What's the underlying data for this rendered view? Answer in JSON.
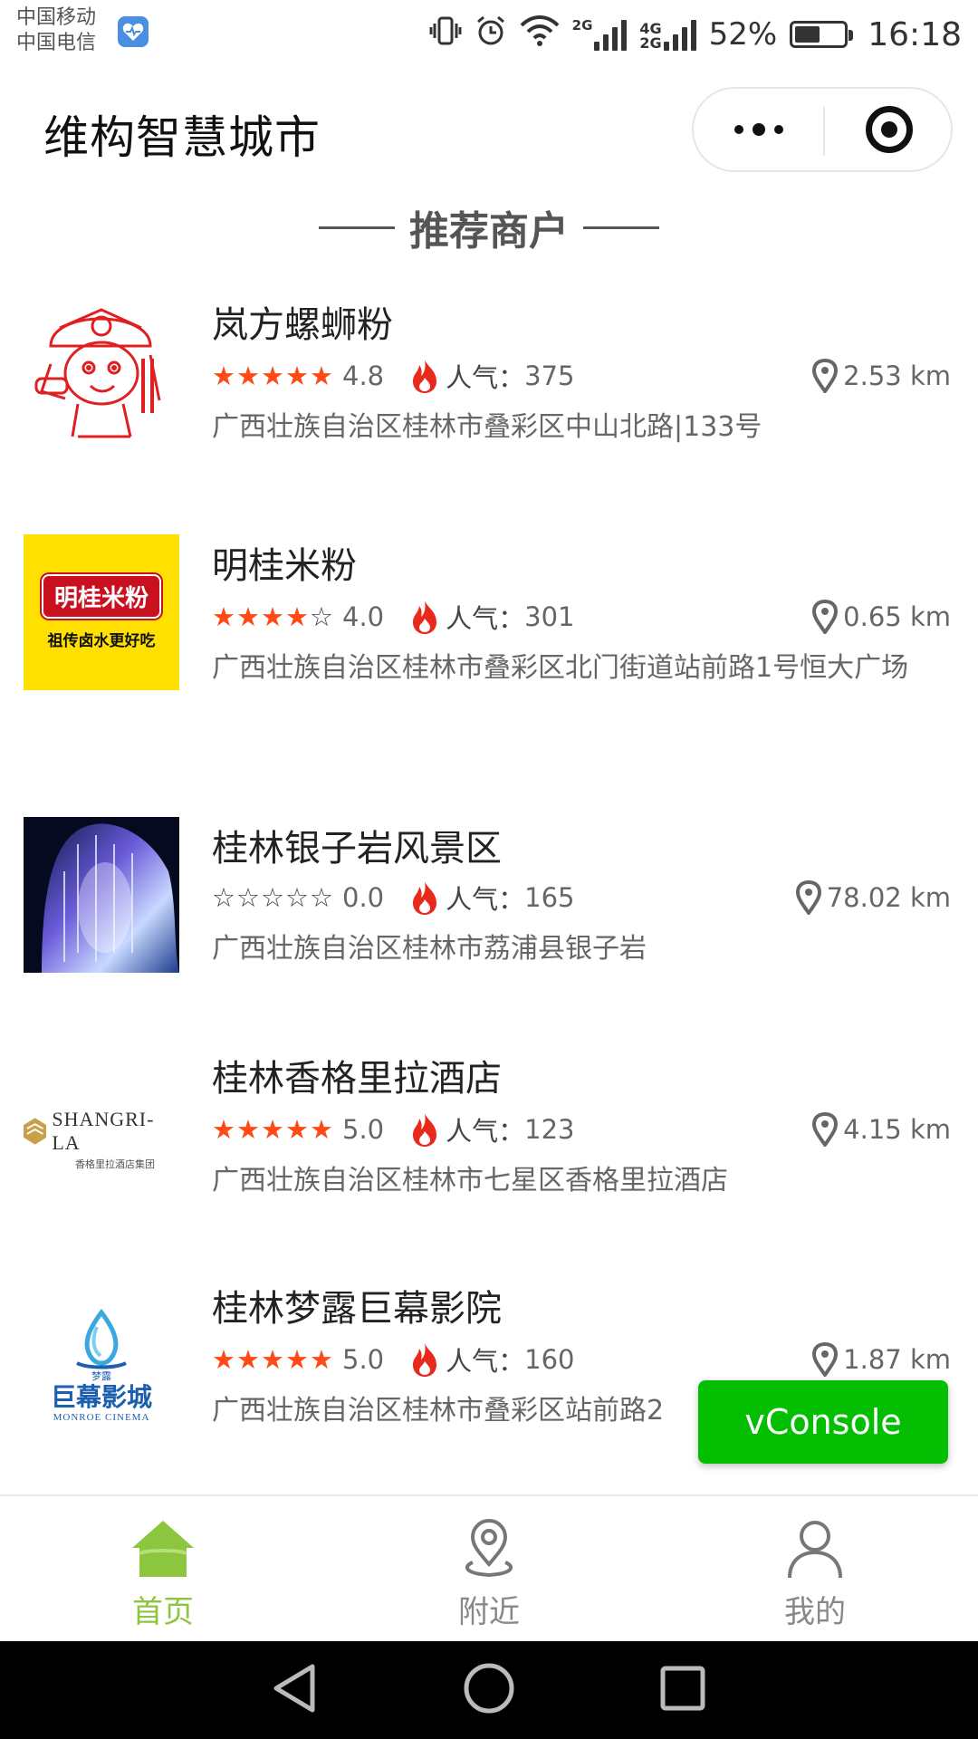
{
  "status_bar": {
    "carrier_1": "中国移动",
    "carrier_2": "中国电信",
    "net_tag_top": "4G",
    "net_tag_bottom": "2G",
    "net_tag_small": "2G",
    "battery_percent": "52%",
    "battery_level": 0.52,
    "time": "16:18"
  },
  "header": {
    "title": "维构智慧城市",
    "more_icon": "more-dots-icon",
    "close_icon": "target-close-icon"
  },
  "section": {
    "title": "推荐商户"
  },
  "merchants": [
    {
      "name": "岚方螺蛳粉",
      "stars_filled": 5,
      "rating": "4.8",
      "popularity_label": "人气：",
      "popularity": "375",
      "distance": "2.53 km",
      "address": "广西壮族自治区桂林市叠彩区中山北路|133号",
      "thumb_icon": "cartoon-chef-logo"
    },
    {
      "name": "明桂米粉",
      "stars_filled": 4,
      "rating": "4.0",
      "popularity_label": "人气：",
      "popularity": "301",
      "distance": "0.65 km",
      "address": "广西壮族自治区桂林市叠彩区北门街道站前路1号恒大广场",
      "thumb_logo_text": "明桂米粉",
      "thumb_slogan": "祖传卤水更好吃"
    },
    {
      "name": "桂林银子岩风景区",
      "stars_filled": 0,
      "rating": "0.0",
      "popularity_label": "人气：",
      "popularity": "165",
      "distance": "78.02 km",
      "address": "广西壮族自治区桂林市荔浦县银子岩",
      "thumb_icon": "cave-photo"
    },
    {
      "name": "桂林香格里拉酒店",
      "stars_filled": 5,
      "rating": "5.0",
      "popularity_label": "人气：",
      "popularity": "123",
      "distance": "4.15 km",
      "address": "广西壮族自治区桂林市七星区香格里拉酒店",
      "thumb_logo_text": "SHANGRI-LA",
      "thumb_sub": "香格里拉酒店集团"
    },
    {
      "name": "桂林梦露巨幕影院",
      "stars_filled": 5,
      "rating": "5.0",
      "popularity_label": "人气：",
      "popularity": "160",
      "distance": "1.87 km",
      "address": "广西壮族自治区桂林市叠彩区站前路2",
      "thumb_top": "梦露",
      "thumb_logo_text": "巨幕影城",
      "thumb_sub": "MONROE CINEMA"
    }
  ],
  "vconsole": {
    "label": "vConsole"
  },
  "tabbar": {
    "tabs": [
      {
        "label": "首页",
        "icon": "home-icon",
        "active": true
      },
      {
        "label": "附近",
        "icon": "location-icon",
        "active": false
      },
      {
        "label": "我的",
        "icon": "user-icon",
        "active": false
      }
    ],
    "active_color": "#8cc63f"
  },
  "colors": {
    "star": "#ff4a17",
    "fire": "#e8291c",
    "vconsole": "#04be02"
  }
}
